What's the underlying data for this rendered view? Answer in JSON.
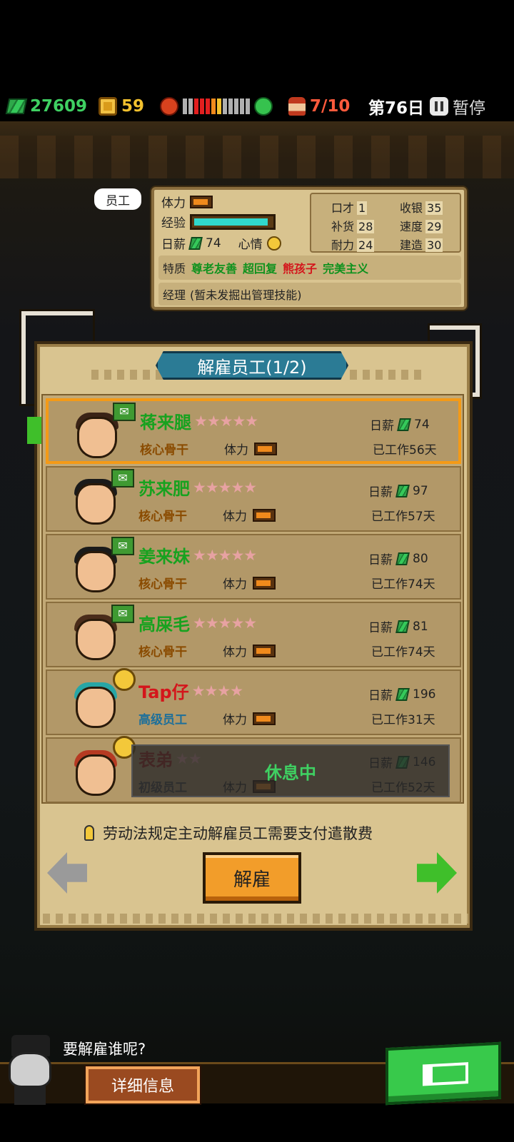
{
  "topbar": {
    "money": "27609",
    "coins": "59",
    "mood_levels": [
      "#b0b0b0",
      "#b0b0b0",
      "#e21f1f",
      "#e21f1f",
      "#e21f1f",
      "#f08a1c",
      "#f3c12e",
      "#b0b0b0",
      "#b0b0b0",
      "#b0b0b0",
      "#b0b0b0",
      "#b0b0b0"
    ],
    "staff": "7/10",
    "day": "第76日",
    "pause_label": "暂停",
    "icons": [
      "money-icon",
      "coin-icon",
      "angry-icon",
      "happy-icon",
      "staff-icon",
      "pause-icon"
    ]
  },
  "stat_panel": {
    "tag": "员工",
    "stamina_label": "体力",
    "exp_label": "经验",
    "exp_fraction": 0.95,
    "salary_label": "日薪",
    "salary": "74",
    "mood_label": "心情",
    "attrs": {
      "eloquence_label": "口才",
      "eloquence": "1",
      "cashier_label": "收银",
      "cashier": "35",
      "restock_label": "补货",
      "restock": "28",
      "speed_label": "速度",
      "speed": "29",
      "endurance_label": "耐力",
      "endurance": "24",
      "build_label": "建造",
      "build": "30"
    },
    "trait_label": "特质",
    "traits": [
      {
        "text": "尊老友善",
        "color": "green"
      },
      {
        "text": "超回复",
        "color": "green"
      },
      {
        "text": "熊孩子",
        "color": "red"
      },
      {
        "text": "完美主义",
        "color": "green"
      }
    ],
    "manager_label": "经理",
    "manager_text": "(暂未发掘出管理技能)"
  },
  "dialog": {
    "title": "解雇员工(1/2)",
    "hint": "劳动法规定主动解雇员工需要支付遣散费",
    "fire_button": "解雇"
  },
  "employees": [
    {
      "name": "蒋来腿",
      "stars": "★★★★★",
      "role": "核心骨干",
      "stamina_label": "体力",
      "salary_label": "日薪",
      "salary": "74",
      "days": "已工作56天",
      "selected": true,
      "name_color": "#17a21f",
      "role_color": "#8a4b00",
      "badge": "mail"
    },
    {
      "name": "苏来肥",
      "stars": "★★★★★",
      "role": "核心骨干",
      "stamina_label": "体力",
      "salary_label": "日薪",
      "salary": "97",
      "days": "已工作57天",
      "selected": false,
      "name_color": "#17a21f",
      "role_color": "#8a4b00",
      "badge": "mail"
    },
    {
      "name": "姜来妹",
      "stars": "★★★★★",
      "role": "核心骨干",
      "stamina_label": "体力",
      "salary_label": "日薪",
      "salary": "80",
      "days": "已工作74天",
      "selected": false,
      "name_color": "#17a21f",
      "role_color": "#8a4b00",
      "badge": "mail"
    },
    {
      "name": "高屎毛",
      "stars": "★★★★★",
      "role": "核心骨干",
      "stamina_label": "体力",
      "salary_label": "日薪",
      "salary": "81",
      "days": "已工作74天",
      "selected": false,
      "name_color": "#17a21f",
      "role_color": "#8a4b00",
      "badge": "mail"
    },
    {
      "name": "Tap仔",
      "stars": "★★★★",
      "role": "高级员工",
      "stamina_label": "体力",
      "salary_label": "日薪",
      "salary": "196",
      "days": "已工作31天",
      "selected": false,
      "name_color": "#d4151b",
      "role_color": "#1d6f9a",
      "badge": "mood"
    },
    {
      "name": "表弟",
      "stars": "★★",
      "role": "初级员工",
      "stamina_label": "体力",
      "salary_label": "日薪",
      "salary": "146",
      "days": "已工作52天",
      "selected": false,
      "name_color": "#a0231a",
      "role_color": "#444",
      "badge": "mood",
      "status": "休息中"
    }
  ],
  "footer": {
    "speech": "要解雇谁呢?",
    "detail_button": "详细信息"
  }
}
